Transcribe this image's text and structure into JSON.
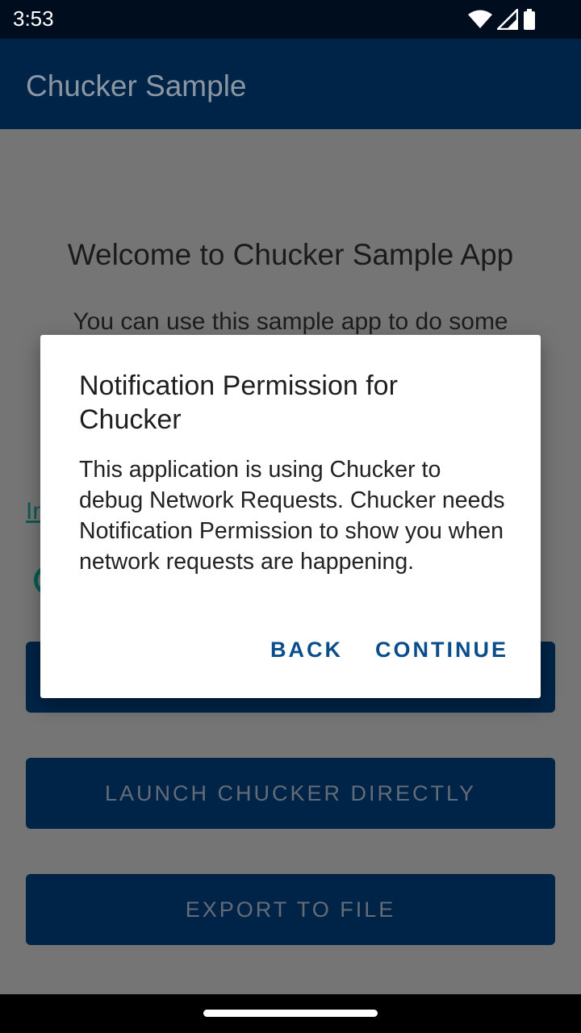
{
  "status_bar": {
    "time": "3:53"
  },
  "app_bar": {
    "title": "Chucker Sample"
  },
  "main": {
    "welcome_title": "Welcome to Chucker Sample App",
    "description": "You can use this sample app to do some",
    "link_partial": "In",
    "buttons": [
      {
        "label": ""
      },
      {
        "label": "LAUNCH CHUCKER DIRECTLY"
      },
      {
        "label": "EXPORT TO FILE"
      }
    ]
  },
  "dialog": {
    "title": "Notification Permission for Chucker",
    "message": "This application is using Chucker to debug Network Requests. Chucker needs Notification Permission to show you when network requests are happening.",
    "back_label": "BACK",
    "continue_label": "CONTINUE"
  },
  "colors": {
    "app_bar": "#002447",
    "status_bar": "#000d1f",
    "scrim_background": "#757575",
    "dialog_button": "#0a4d8c",
    "accent_teal": "#0a5a55"
  },
  "icons": [
    "wifi-icon",
    "cell-signal-icon",
    "battery-icon"
  ]
}
